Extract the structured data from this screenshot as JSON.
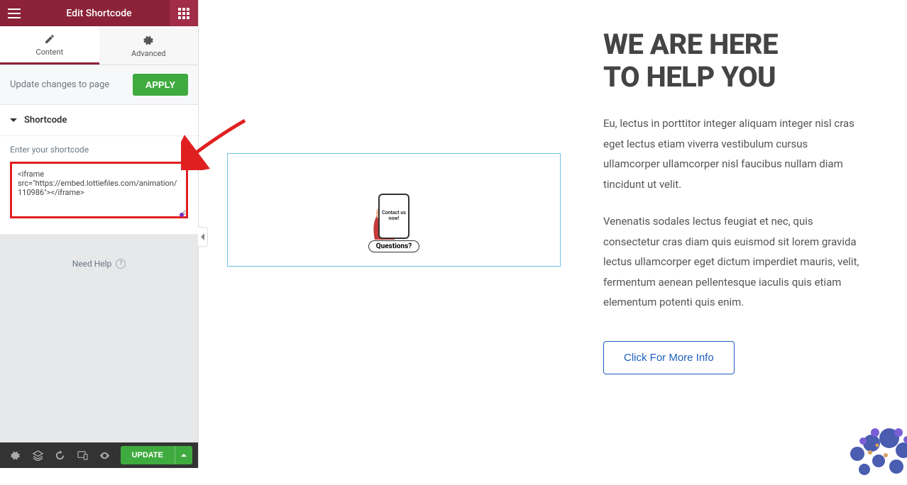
{
  "sidebar": {
    "title": "Edit Shortcode",
    "tabs": {
      "content": "Content",
      "advanced": "Advanced"
    },
    "update_row_text": "Update changes to page",
    "apply_label": "APPLY",
    "section_title": "Shortcode",
    "field_label": "Enter your shortcode",
    "shortcode_value": "<iframe src=\"https://embed.lottiefiles.com/animation/110986\"></iframe>",
    "need_help_label": "Need Help"
  },
  "bottom_bar": {
    "update_label": "UPDATE"
  },
  "canvas": {
    "phone_text": "Contact us now!",
    "questions_label": "Questions?",
    "heading_line1": "WE ARE HERE",
    "heading_line2": "TO HELP YOU",
    "para1": "Eu, lectus in porttitor integer aliquam integer nisl cras eget lectus etiam viverra vestibulum cursus ullamcorper ullamcorper nisl faucibus nullam diam tincidunt ut velit.",
    "para2": "Venenatis sodales lectus feugiat et nec, quis consectetur cras diam quis euismod sit lorem gravida lectus ullamcorper eget dictum imperdiet mauris, velit, fermentum aenean pellentesque iaculis quis etiam elementum potenti quis enim.",
    "cta_label": "Click For More Info"
  }
}
